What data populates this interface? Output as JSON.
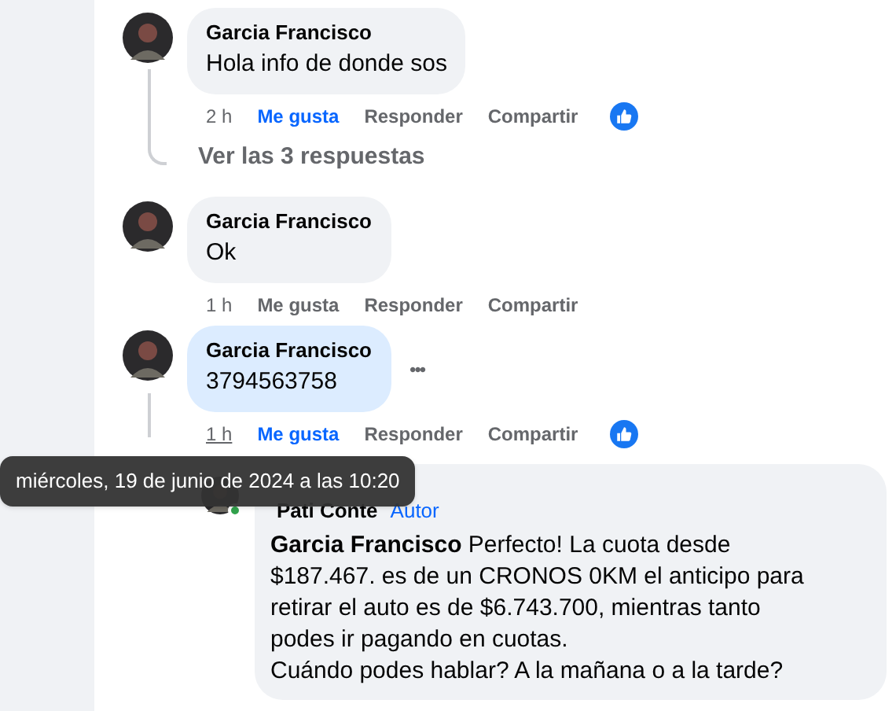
{
  "comments": [
    {
      "name": "Garcia Francisco",
      "text": "Hola info de donde sos",
      "highlighted": false,
      "time": "2 h",
      "time_hovered": false,
      "like": "Me gusta",
      "liked": true,
      "reply": "Responder",
      "share": "Compartir",
      "reacted": true
    },
    {
      "name": "Garcia Francisco",
      "text": "Ok",
      "highlighted": false,
      "time": "1 h",
      "time_hovered": false,
      "like": "Me gusta",
      "liked": false,
      "reply": "Responder",
      "share": "Compartir",
      "reacted": false
    },
    {
      "name": "Garcia Francisco",
      "text": "3794563758",
      "highlighted": true,
      "more": "•••",
      "time": "1 h",
      "time_hovered": true,
      "like": "Me gusta",
      "liked": true,
      "reply": "Responder",
      "share": "Compartir",
      "reacted": true
    }
  ],
  "view_replies": "Ver las 3 respuestas",
  "reply": {
    "name": "Pati Conte",
    "badge": "Autor",
    "online": true,
    "mention": "Garcia Francisco",
    "text": "Perfecto! La cuota desde $187.467. es de un CRONOS 0KM el anticipo para retirar el auto es de $6.743.700, mientras tanto podes ir pagando en cuotas.\nCuándo podes hablar? A la mañana o a la tarde?"
  },
  "tooltip": "miércoles, 19 de junio de 2024 a las 10:20"
}
